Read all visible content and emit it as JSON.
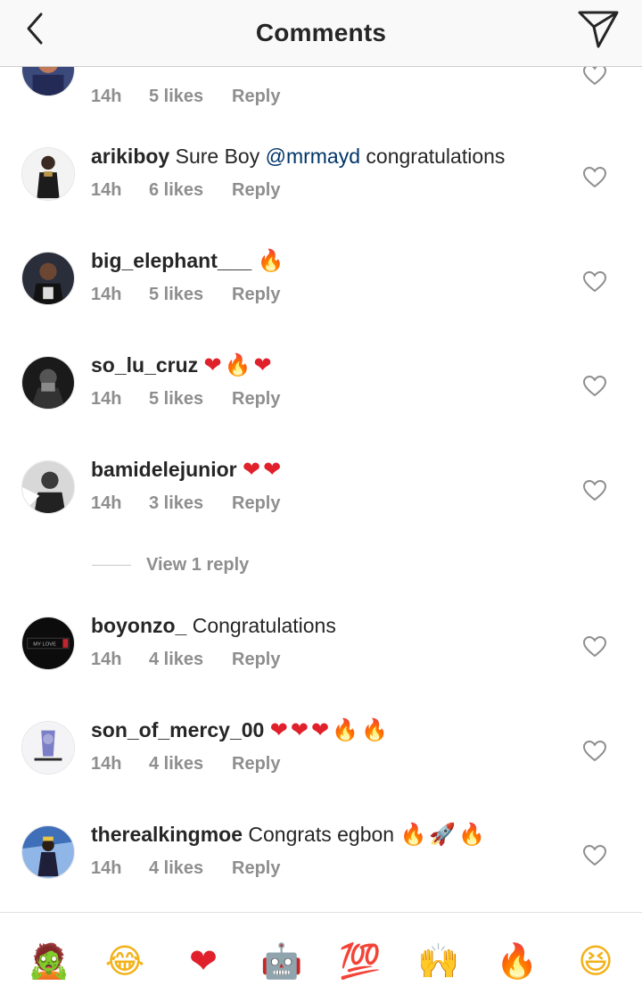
{
  "header": {
    "title": "Comments",
    "back_icon": "chevron-left-icon",
    "send_icon": "paper-plane-icon"
  },
  "colors": {
    "text": "#262626",
    "meta": "#8e8e8e",
    "mention": "#003569",
    "header_bg": "#f9f9f9",
    "heart": "#e0202b",
    "fire": "#f26a1b"
  },
  "partial_comment": {
    "time": "14h",
    "likes": "5 likes",
    "reply": "Reply"
  },
  "comments": [
    {
      "username": "arikiboy",
      "text": "Sure Boy",
      "mention": "@mrmayd",
      "text_after": "congratulations",
      "emojis": "",
      "time": "14h",
      "likes": "6 likes",
      "reply": "Reply"
    },
    {
      "username": "big_elephant___",
      "text": "",
      "mention": "",
      "text_after": "",
      "emojis": "🔥",
      "time": "14h",
      "likes": "5 likes",
      "reply": "Reply"
    },
    {
      "username": "so_lu_cruz",
      "text": "",
      "mention": "",
      "text_after": "",
      "emojis": "❤🔥❤",
      "time": "14h",
      "likes": "5 likes",
      "reply": "Reply"
    },
    {
      "username": "bamidelejunior",
      "text": "",
      "mention": "",
      "text_after": "",
      "emojis": "❤❤",
      "time": "14h",
      "likes": "3 likes",
      "reply": "Reply"
    },
    {
      "username": "boyonzo_",
      "text": "Congratulations",
      "mention": "",
      "text_after": "",
      "emojis": "",
      "time": "14h",
      "likes": "4 likes",
      "reply": "Reply"
    },
    {
      "username": "son_of_mercy_00",
      "text": "",
      "mention": "",
      "text_after": "",
      "emojis": "❤❤❤🔥🔥",
      "time": "14h",
      "likes": "4 likes",
      "reply": "Reply"
    },
    {
      "username": "therealkingmoe",
      "text": "Congrats egbon",
      "mention": "",
      "text_after": "",
      "emojis": "🔥🚀🔥",
      "time": "14h",
      "likes": "4 likes",
      "reply": "Reply"
    }
  ],
  "view_replies": {
    "label": "View 1 reply"
  },
  "avatar_labels": {
    "boyonzo_": "MY LOVE"
  },
  "emoji_bar": [
    "🧟",
    "😂",
    "❤",
    "🤖",
    "💯",
    "🙌",
    "🔥",
    "😆"
  ]
}
